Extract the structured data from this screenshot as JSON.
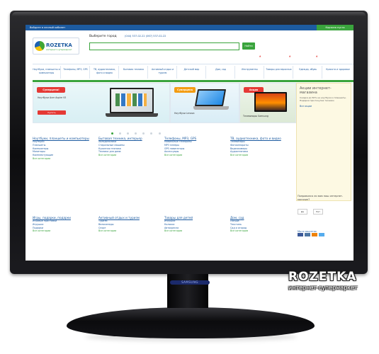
{
  "watermark": {
    "title": "ROZETKA",
    "subtitle": "интернет-супермаркет"
  },
  "monitor_brand": "SAMSUNG",
  "site": {
    "logo_word": "ROZETKA",
    "logo_tag": "интернет-супермаркет",
    "choose": "Выберите город",
    "phones": "(044) 537-02-22 (067) 537-02-22",
    "header_links": "Войдите в личный кабинет",
    "search_button": "Найти",
    "cart": "Корзина пуста",
    "nav_items": [
      "Ноутбуки, планшеты и компьютеры",
      "Телефоны, MP3, GPS",
      "ТВ, аудиотехника, фото и видео",
      "Бытовая техника",
      "Активный отдых и туризм",
      "Детский мир",
      "Дом, сад",
      "Инструменты",
      "Товары для взрослых",
      "Одежда, обувь",
      "Красота и здоровье"
    ],
    "banner1": {
      "badge": "Суперцена!",
      "caption": "Ноутбуки Acer Aspire V5",
      "cta": "Купить"
    },
    "banner2": {
      "badge": "Суперцена",
      "caption": "Ноутбуки Lenovo"
    },
    "banner3": {
      "badge": "Акция",
      "caption": "Телевизоры Samsung"
    },
    "categories": [
      {
        "title": "Ноутбуки, планшеты и компьютеры",
        "items": [
          "Ноутбуки",
          "Планшеты",
          "Компьютеры",
          "Мониторы",
          "Комплектующие"
        ],
        "more": "Все категории"
      },
      {
        "title": "Бытовая техника, интерьер",
        "items": [
          "Холодильники",
          "Стиральные машины",
          "Кухонная техника",
          "Техника для дома"
        ],
        "more": "Все категории"
      },
      {
        "title": "Телефоны, MP3, GPS",
        "items": [
          "Мобильные телефоны",
          "MP3 плееры",
          "GPS навигаторы",
          "Аксессуары"
        ],
        "more": "Все категории"
      },
      {
        "title": "ТВ, аудиотехника, фото и видео",
        "items": [
          "Телевизоры",
          "Фотоаппараты",
          "Видеокамеры",
          "Аудиотехника"
        ],
        "more": "Все категории"
      },
      {
        "title": "Игры, подарки, подарки",
        "items": [
          "Игровые приставки",
          "Игрушки",
          "Подарки"
        ],
        "more": "Все категории"
      },
      {
        "title": "Активный отдых и туризм",
        "items": [
          "Туризм",
          "Велосипеды",
          "Спорт"
        ],
        "more": "Все категории"
      },
      {
        "title": "Товары для детей",
        "items": [
          "Игрушки",
          "Коляски",
          "Автокресла"
        ],
        "more": "Все категории"
      },
      {
        "title": "Дом, сад",
        "items": [
          "Посуда",
          "Текстиль",
          "Сад и огород"
        ],
        "more": "Все категории"
      }
    ],
    "sidebar": {
      "heading": "Акции интернет-магазина",
      "text": "Скидки до 50% на ноутбуки и планшеты. Подарки при покупке техники.",
      "link": "Все акции"
    },
    "poll": {
      "question": "Понравился ли вам наш интернет-магазин?",
      "options": [
        "Да",
        "Нет"
      ]
    },
    "social": "Мы в соцсетях"
  }
}
